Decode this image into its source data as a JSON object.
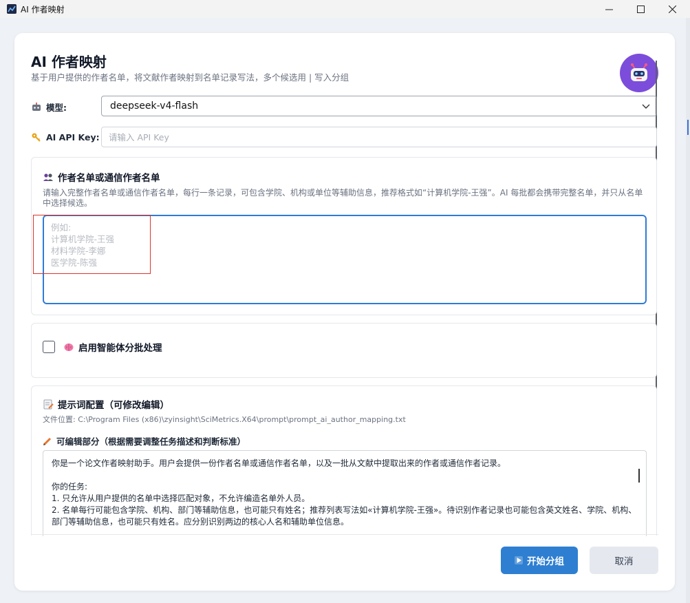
{
  "window": {
    "title": "AI 作者映射"
  },
  "header": {
    "title": "AI 作者映射",
    "subtitle": "基于用户提供的作者名单，将文献作者映射到名单记录写法，多个候选用 | 写入分组"
  },
  "model": {
    "label": "模型:",
    "value": "deepseek-v4-flash"
  },
  "api_key": {
    "label": "AI API Key:",
    "placeholder": "请输入 API Key",
    "value": ""
  },
  "authors": {
    "title": "作者名单或通信作者名单",
    "description": "请输入完整作者名单或通信作者名单，每行一条记录，可包含学院、机构或单位等辅助信息，推荐格式如“计算机学院-王强”。AI 每批都会携带完整名单，并只从名单中选择候选。",
    "placeholder": "例如:\n计算机学院-王强\n材料学院-李娜\n医学院-陈强"
  },
  "agent": {
    "label": "启用智能体分批处理",
    "checked": false
  },
  "prompt": {
    "title": "提示词配置（可修改编辑）",
    "file_location": "文件位置: C:\\Program Files (x86)\\zyinsight\\SciMetrics.X64\\prompt\\prompt_ai_author_mapping.txt",
    "editable_label": "可编辑部分（根据需要调整任务描述和判断标准）",
    "lines": [
      "你是一个论文作者映射助手。用户会提供一份作者名单或通信作者名单，以及一批从文献中提取出来的作者或通信作者记录。",
      "",
      "你的任务:",
      "1. 只允许从用户提供的名单中选择匹配对象，不允许编造名单外人员。",
      "2. 名单每行可能包含学院、机构、部门等辅助信息，也可能只有姓名；推荐列表写法如«计算机学院-王强»。待识别作者记录也可能包含英文姓名、学院、机构、部门等辅助信息，也可能只有姓名。应分别识别两边的核心人名和辅助单位信息。"
    ]
  },
  "buttons": {
    "start": "开始分组",
    "cancel": "取消"
  },
  "colors": {
    "primary": "#2e7fd1",
    "avatar": "#7c4ddb",
    "highlight": "#d9342b"
  }
}
